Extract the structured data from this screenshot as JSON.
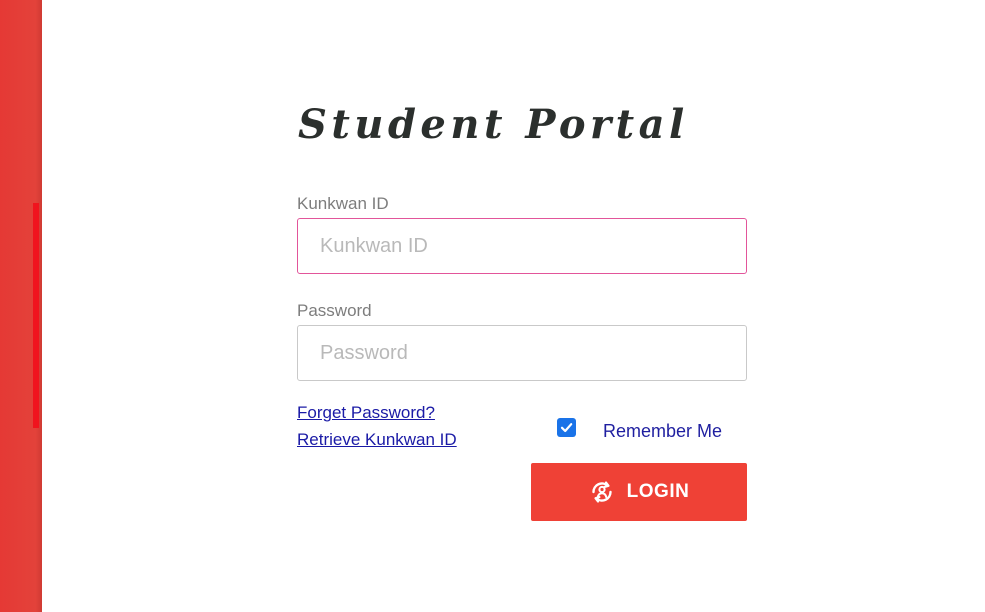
{
  "title": "Student Portal",
  "form": {
    "id_label": "Kunkwan ID",
    "id_placeholder": "Kunkwan ID",
    "id_value": "",
    "password_label": "Password",
    "password_placeholder": "Password",
    "password_value": ""
  },
  "links": {
    "forget_password": "Forget Password?",
    "retrieve_id": "Retrieve Kunkwan ID"
  },
  "remember": {
    "label": "Remember Me",
    "checked": true
  },
  "login": {
    "label": "LOGIN",
    "icon": "login-icon"
  },
  "colors": {
    "accent": "#ef4136",
    "sidebar": "#e53935",
    "link": "#1a1aa6",
    "focus_border": "#e2559a",
    "checkbox": "#1a73e8"
  }
}
